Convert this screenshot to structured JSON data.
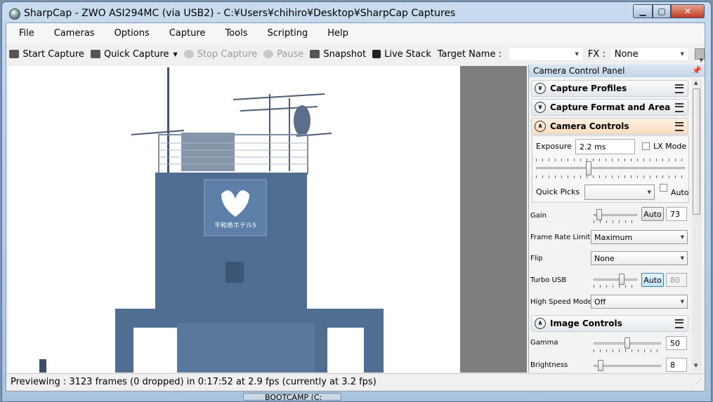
{
  "window": {
    "title": "SharpCap - ZWO ASI294MC (via USB2) - C:¥Users¥chihiro¥Desktop¥SharpCap Captures",
    "controls": {
      "minimize": "▁",
      "maximize": "▢",
      "close": "✕"
    }
  },
  "menu": [
    "File",
    "Cameras",
    "Options",
    "Capture",
    "Tools",
    "Scripting",
    "Help"
  ],
  "toolbar": {
    "start_capture": "Start Capture",
    "quick_capture": "Quick Capture",
    "stop_capture": "Stop Capture",
    "pause": "Pause",
    "snapshot": "Snapshot",
    "live_stack": "Live Stack",
    "target_name_label": "Target Name :",
    "target_name_value": "",
    "fx_label": "FX :",
    "fx_value": "None"
  },
  "status": {
    "text": "Previewing : 3123 frames (0 dropped) in 0:17:52 at 2.9 fps  (currently at 3.2 fps)"
  },
  "panel": {
    "title": "Camera Control Panel",
    "sections": {
      "capture_profiles": "Capture Profiles",
      "capture_format": "Capture Format and Area",
      "camera_controls": "Camera Controls",
      "image_controls": "Image Controls"
    },
    "exposure": {
      "label": "Exposure",
      "value": "2.2 ms",
      "lx_mode": "LX Mode",
      "lx_checked": false
    },
    "quick_picks": {
      "label": "Quick Picks",
      "value": "",
      "auto": "Auto",
      "auto_checked": false
    },
    "gain": {
      "label": "Gain",
      "auto": "Auto",
      "value": "73",
      "slider_fraction": 0.1
    },
    "frame_rate": {
      "label": "Frame Rate Limit",
      "value": "Maximum"
    },
    "flip": {
      "label": "Flip",
      "value": "None"
    },
    "turbo_usb": {
      "label": "Turbo USB",
      "auto": "Auto",
      "value": "80",
      "slider_fraction": 0.45
    },
    "high_speed": {
      "label": "High Speed Mode",
      "value": "Off"
    },
    "gamma": {
      "label": "Gamma",
      "value": "50",
      "slider_fraction": 0.5
    },
    "brightness": {
      "label": "Brightness",
      "value": "8",
      "slider_fraction": 0.1
    }
  },
  "preview_image": {
    "sign_text": "平和島ホテル5"
  },
  "taskbar": {
    "button": "BOOTCAMP (C:"
  },
  "colors": {
    "accent_section": "#f8dcc0",
    "panel_header": "#c4d4e8",
    "building": "#4f6e92"
  }
}
